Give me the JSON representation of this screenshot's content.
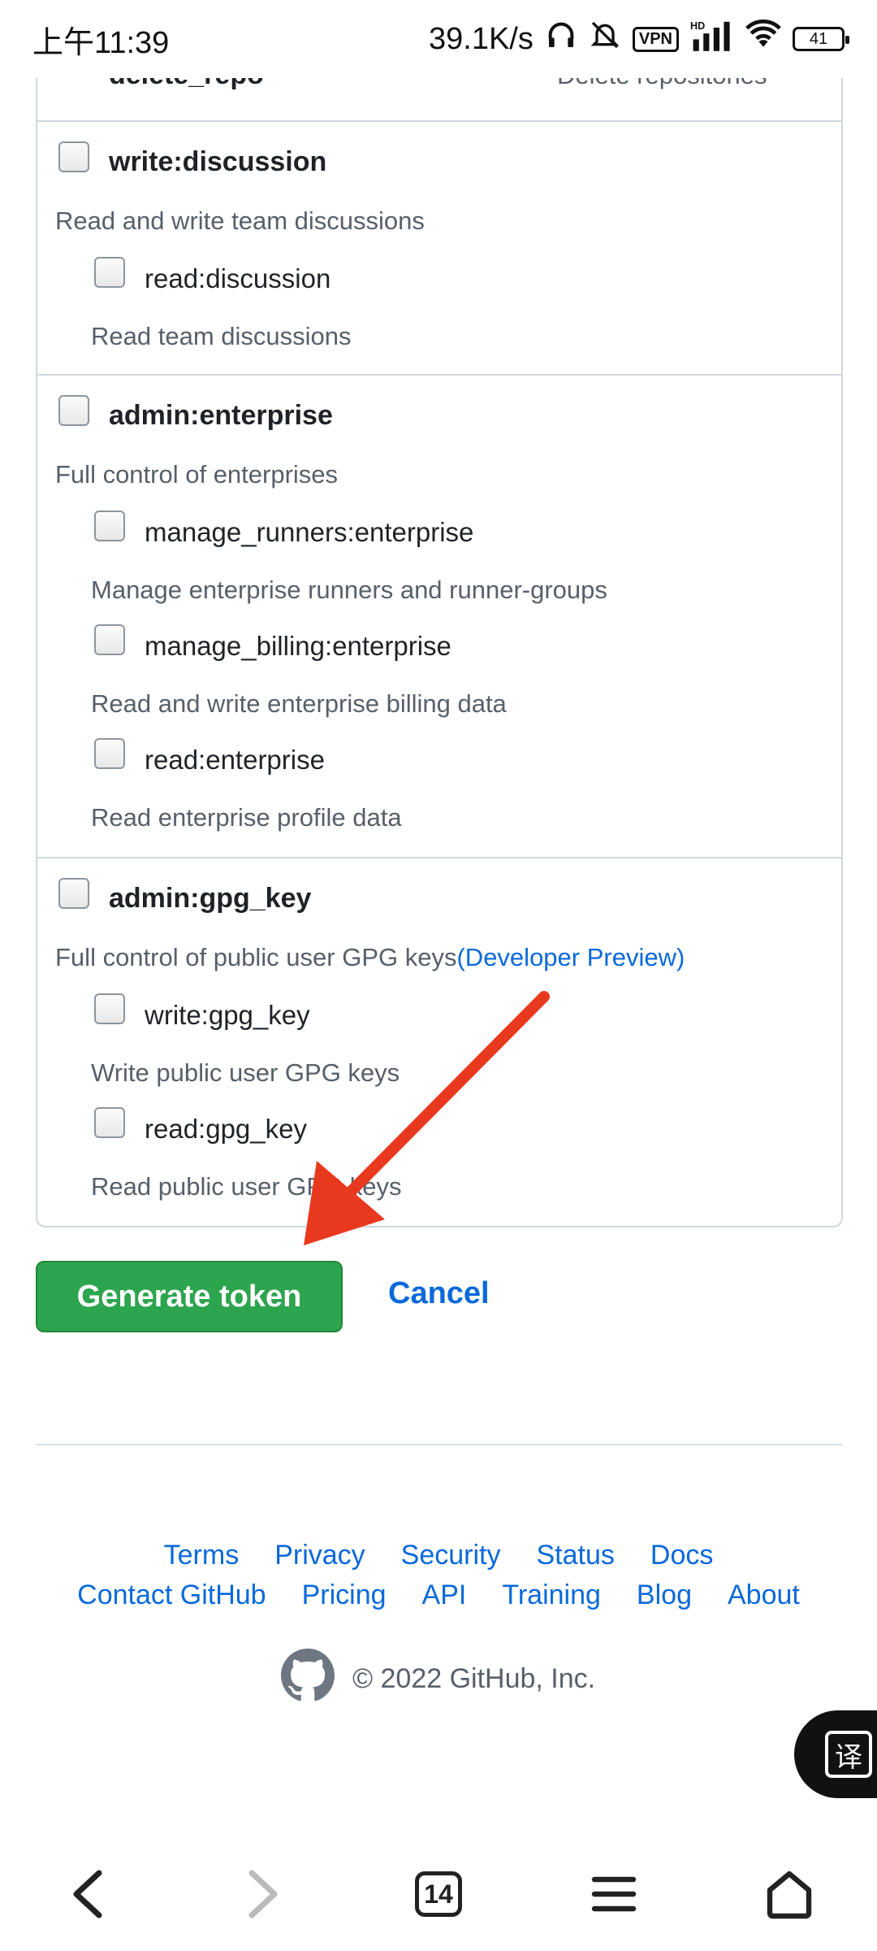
{
  "status_bar": {
    "time": "上午11:39",
    "network_speed": "39.1K/s",
    "vpn_badge": "VPN",
    "hd_label": "HD",
    "battery": "41"
  },
  "scopes": {
    "partial_top": {
      "label": "delete_repo",
      "description": "Delete repositories"
    },
    "groups": [
      {
        "label": "write:discussion",
        "description": "Read and write team discussions",
        "children": [
          {
            "label": "read:discussion",
            "description": "Read team discussions"
          }
        ]
      },
      {
        "label": "admin:enterprise",
        "description": "Full control of enterprises",
        "children": [
          {
            "label": "manage_runners:enterprise",
            "description": "Manage enterprise runners and runner-groups"
          },
          {
            "label": "manage_billing:enterprise",
            "description": "Read and write enterprise billing data"
          },
          {
            "label": "read:enterprise",
            "description": "Read enterprise profile data"
          }
        ]
      },
      {
        "label": "admin:gpg_key",
        "description": "Full control of public user GPG keys",
        "description_link": "(Developer Preview)",
        "children": [
          {
            "label": "write:gpg_key",
            "description": "Write public user GPG keys"
          },
          {
            "label": "read:gpg_key",
            "description": "Read public user GPG keys"
          }
        ]
      }
    ]
  },
  "actions": {
    "generate_label": "Generate token",
    "cancel_label": "Cancel"
  },
  "annotation": {
    "arrow_color": "#e8391f"
  },
  "footer": {
    "row1": [
      "Terms",
      "Privacy",
      "Security",
      "Status",
      "Docs"
    ],
    "row2": [
      "Contact GitHub",
      "Pricing",
      "API",
      "Training",
      "Blog",
      "About"
    ],
    "copyright": "© 2022 GitHub, Inc."
  },
  "translate_button": {
    "glyph": "译"
  },
  "nav_bar": {
    "tab_count": "14",
    "icons": [
      "back-icon",
      "forward-icon",
      "tabs-icon",
      "menu-icon",
      "home-icon"
    ]
  },
  "colors": {
    "primary_button": "#2da44e",
    "link": "#0969da",
    "muted_text": "#57606a",
    "border": "#d0d7de"
  }
}
